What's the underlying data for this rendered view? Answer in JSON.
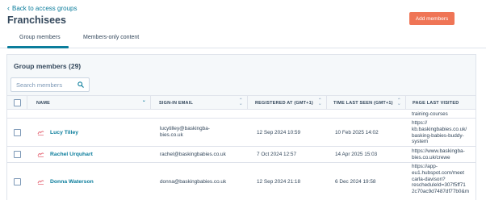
{
  "header": {
    "back_label": "Back to access groups",
    "title": "Franchisees",
    "add_button": "Add members"
  },
  "tabs": [
    {
      "label": "Group members",
      "active": true
    },
    {
      "label": "Members-only content",
      "active": false
    }
  ],
  "panel": {
    "title": "Group members (29)",
    "search_placeholder": "Search members"
  },
  "table": {
    "columns": [
      "NAME",
      "SIGN-IN EMAIL",
      "REGISTERED AT (GMT+1)",
      "TIME LAST SEEN (GMT+1)",
      "PAGE LAST VISITED"
    ],
    "overflow_text": "training-courses",
    "rows": [
      {
        "name": "Lucy Tilley",
        "email": "lucytilley@baskingba-\nbies.co.uk",
        "registered": "12 Sep 2024 10:59",
        "last_seen": "10 Feb 2025 14:02",
        "page": "https://\nkb.baskingbabies.co.uk/\nbasking-babies-buddy-\nsystem"
      },
      {
        "name": "Rachel Urquhart",
        "email": "rachel@baskingbabies.co.uk",
        "registered": "7 Oct 2024 12:57",
        "last_seen": "14 Apr 2025 15:03",
        "page": "https://www.baskingba-\nbies.co.uk/crewe"
      },
      {
        "name": "Donna Waterson",
        "email": "donna@baskingbabies.co.uk",
        "registered": "12 Sep 2024 21:18",
        "last_seen": "6 Dec 2024 19:58",
        "page": "https://app-\neu1.hubspot.com/meet\ncarla-davison?\nrescheduleId=307f5ff71\n2c70ac9d7487df77b0&m"
      }
    ]
  },
  "colors": {
    "accent": "#0b7d9c",
    "primary_button": "#ef7556",
    "text": "#33475b",
    "border": "#dfe3eb"
  },
  "icons": {
    "back": "chevron-left-icon",
    "search": "search-icon",
    "contact": "contact-icon",
    "sort": "sort-icon"
  }
}
